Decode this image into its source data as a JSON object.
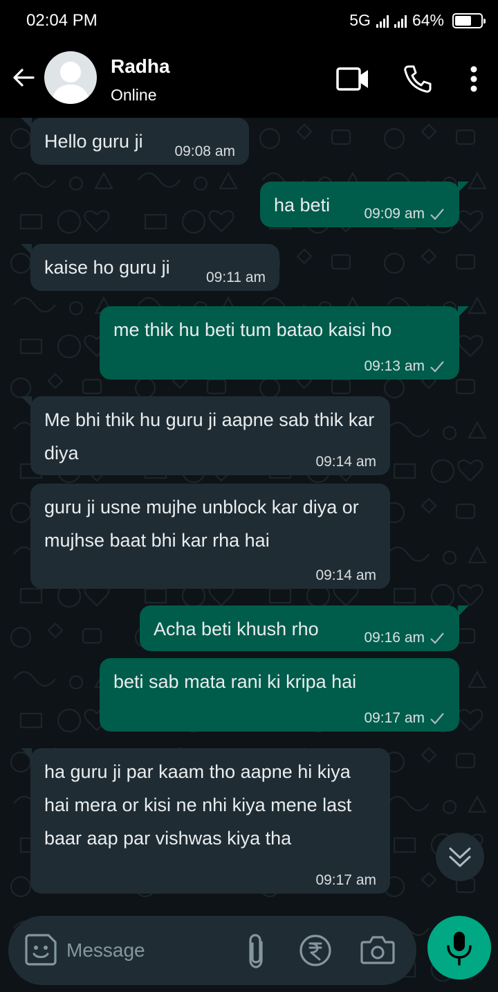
{
  "status_bar": {
    "time": "02:04 PM",
    "network": "5G",
    "battery": "64%",
    "battery_level": 0.64
  },
  "header": {
    "name": "Radha",
    "status": "Online",
    "icons": [
      "back-arrow-icon",
      "avatar",
      "video-call-icon",
      "phone-icon",
      "more-vertical-icon"
    ]
  },
  "messages": [
    {
      "dir": "in",
      "text": "Hello guru ji",
      "time": "09:08 am"
    },
    {
      "dir": "out",
      "text": "ha beti",
      "time": "09:09 am",
      "status": "sent"
    },
    {
      "dir": "in",
      "text": "kaise ho guru ji",
      "time": "09:11 am"
    },
    {
      "dir": "out",
      "text": "me thik hu beti tum batao kaisi ho",
      "time": "09:13 am",
      "status": "sent"
    },
    {
      "dir": "in",
      "text": "Me bhi thik hu guru ji aapne sab thik kar diya",
      "time": "09:14 am"
    },
    {
      "dir": "in",
      "text": "guru ji usne mujhe unblock kar diya or mujhse baat bhi kar rha hai",
      "time": "09:14 am"
    },
    {
      "dir": "out",
      "text": "Acha beti khush rho",
      "time": "09:16 am",
      "status": "sent"
    },
    {
      "dir": "out",
      "text": "beti sab mata rani ki kripa hai",
      "time": "09:17 am",
      "status": "sent"
    },
    {
      "dir": "in",
      "text": "ha guru ji par kaam tho aapne hi kiya hai mera or kisi ne nhi kiya mene last baar aap par vishwas kiya tha",
      "time": "09:17 am"
    }
  ],
  "composer": {
    "placeholder": "Message",
    "icons": [
      "sticker-icon",
      "attach-icon",
      "rupee-icon",
      "camera-icon",
      "mic-icon"
    ]
  },
  "colors": {
    "incoming_bubble": "#1f2c33",
    "outgoing_bubble": "#005c4b",
    "mic_button": "#00a884",
    "background": "#0b141a"
  }
}
